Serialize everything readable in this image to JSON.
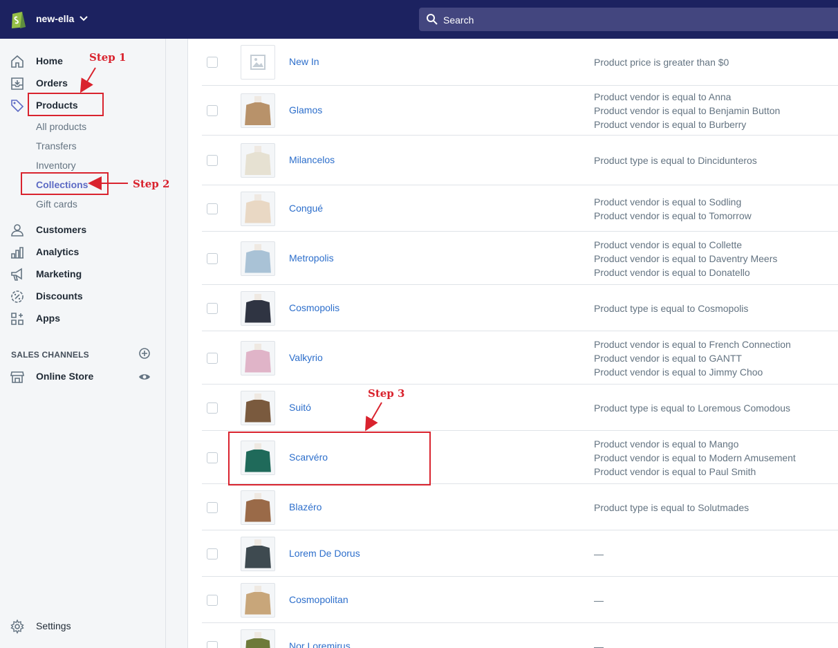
{
  "topbar": {
    "store_name": "new-ella",
    "search_placeholder": "Search"
  },
  "sidebar": {
    "items": [
      {
        "label": "Home",
        "icon": "home-icon"
      },
      {
        "label": "Orders",
        "icon": "orders-icon"
      },
      {
        "label": "Products",
        "icon": "tag-icon"
      },
      {
        "label": "Customers",
        "icon": "person-icon"
      },
      {
        "label": "Analytics",
        "icon": "bar-chart-icon"
      },
      {
        "label": "Marketing",
        "icon": "megaphone-icon"
      },
      {
        "label": "Discounts",
        "icon": "discount-icon"
      },
      {
        "label": "Apps",
        "icon": "apps-icon"
      }
    ],
    "product_subitems": [
      "All products",
      "Transfers",
      "Inventory",
      "Collections",
      "Gift cards"
    ],
    "sales_channels_title": "SALES CHANNELS",
    "online_store": "Online Store",
    "settings": "Settings"
  },
  "collections": [
    {
      "name": "New In",
      "conditions": [
        "Product price is greater than $0"
      ],
      "thumb": "placeholder"
    },
    {
      "name": "Glamos",
      "conditions": [
        "Product vendor is equal to Anna",
        "Product vendor is equal to Benjamin Button",
        "Product vendor is equal to Burberry"
      ],
      "thumb": "#b8926a"
    },
    {
      "name": "Milancelos",
      "conditions": [
        "Product type is equal to Dincidunteros"
      ],
      "thumb": "#e6e1d2"
    },
    {
      "name": "Congué",
      "conditions": [
        "Product vendor is equal to Sodling",
        "Product vendor is equal to Tomorrow"
      ],
      "thumb": "#e9d8c4"
    },
    {
      "name": "Metropolis",
      "conditions": [
        "Product vendor is equal to Collette",
        "Product vendor is equal to Daventry Meers",
        "Product vendor is equal to Donatello"
      ],
      "thumb": "#a9c2d6"
    },
    {
      "name": "Cosmopolis",
      "conditions": [
        "Product type is equal to Cosmopolis"
      ],
      "thumb": "#2f3442"
    },
    {
      "name": "Valkyrio",
      "conditions": [
        "Product vendor is equal to French Connection",
        "Product vendor is equal to GANTT",
        "Product vendor is equal to Jimmy Choo"
      ],
      "thumb": "#e0b4c8"
    },
    {
      "name": "Suitó",
      "conditions": [
        "Product type is equal to Loremous Comodous"
      ],
      "thumb": "#7a5a3e"
    },
    {
      "name": "Scarvéro",
      "conditions": [
        "Product vendor is equal to Mango",
        "Product vendor is equal to Modern Amusement",
        "Product vendor is equal to Paul Smith"
      ],
      "thumb": "#1f6a5a"
    },
    {
      "name": "Blazéro",
      "conditions": [
        "Product type is equal to Solutmades"
      ],
      "thumb": "#9a6a48"
    },
    {
      "name": "Lorem De Dorus",
      "conditions": [
        "—"
      ],
      "thumb": "#3e4a50"
    },
    {
      "name": "Cosmopolitan",
      "conditions": [
        "—"
      ],
      "thumb": "#c8a67a"
    },
    {
      "name": "Nor Loremirus",
      "conditions": [
        "—"
      ],
      "thumb": "#6d7a3a"
    }
  ],
  "annotations": {
    "step1": "Step 1",
    "step2": "Step 2",
    "step3": "Step 3",
    "color": "#d9232e"
  }
}
